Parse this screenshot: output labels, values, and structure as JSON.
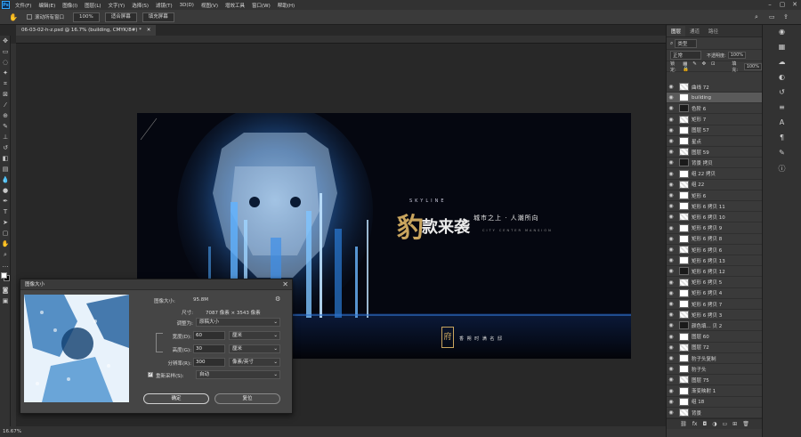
{
  "menubar": {
    "items": [
      "文件(F)",
      "编辑(E)",
      "图像(I)",
      "图层(L)",
      "文字(Y)",
      "选择(S)",
      "滤镜(T)",
      "3D(D)",
      "视图(V)",
      "增效工具",
      "窗口(W)",
      "帮助(H)"
    ]
  },
  "options": {
    "scroll_all_label": "滚动所有窗口",
    "zoom_value": "100%",
    "fit_screen": "适合屏幕",
    "fill_screen": "填充屏幕"
  },
  "document": {
    "tab_title": "06-03-02-h-z.psd @ 16.7% (building, CMYK/8#) *"
  },
  "status": {
    "zoom": "16.67%"
  },
  "artwork": {
    "headline_1": "豹",
    "headline_2": "款来袭",
    "skyline": "SKYLINE",
    "tagline": "城市之上 · 人潮所向",
    "subtitle": "CITY CENTER MANSION",
    "footer_brand": "香 朔 时 满 名 邸"
  },
  "layers_panel": {
    "tabs": [
      "图层",
      "通道",
      "路径"
    ],
    "kind_label": "类型",
    "blend_mode": "正常",
    "opacity_label": "不透明度:",
    "opacity_value": "100%",
    "lock_label": "锁定:",
    "fill_label": "填充:",
    "fill_value": "100%",
    "layers": [
      "曲线 72",
      "building",
      "色阶 6",
      "矩形 7",
      "图层 57",
      "星点",
      "图层 59",
      "背景 拷贝",
      "组 22 拷贝",
      "组 22",
      "矩形 6",
      "矩形 6 拷贝 11",
      "矩形 6 拷贝 10",
      "矩形 6 拷贝 9",
      "矩形 6 拷贝 8",
      "矩形 6 拷贝 6",
      "矩形 6 拷贝 13",
      "矩形 6 拷贝 12",
      "矩形 6 拷贝 5",
      "矩形 6 拷贝 4",
      "矩形 6 拷贝 7",
      "矩形 6 拷贝 3",
      "颜色填... 贝 2",
      "图层 60",
      "图层 72",
      "豹子头复制",
      "豹子头",
      "图层 75",
      "渐变映射 1",
      "组 18",
      "背景"
    ]
  },
  "dialog": {
    "title": "图像大小",
    "image_size_label": "图像大小:",
    "image_size_value": "95.8M",
    "dimensions_label": "尺寸:",
    "dimensions_value": "7087 像素 × 3543 像素",
    "fit_to_label": "调整为:",
    "fit_to_value": "原稿大小",
    "width_label": "宽度(D):",
    "width_value": "60",
    "width_unit": "厘米",
    "height_label": "高度(G):",
    "height_value": "30",
    "height_unit": "厘米",
    "resolution_label": "分辨率(R):",
    "resolution_value": "300",
    "resolution_unit": "像素/英寸",
    "resample_label": "重新采样(S):",
    "resample_value": "自动",
    "ok_label": "确定",
    "cancel_label": "复位"
  },
  "colors": {
    "accent": "#31a8ff",
    "gold": "#c9a55e",
    "canvas_bg": "#050710"
  }
}
